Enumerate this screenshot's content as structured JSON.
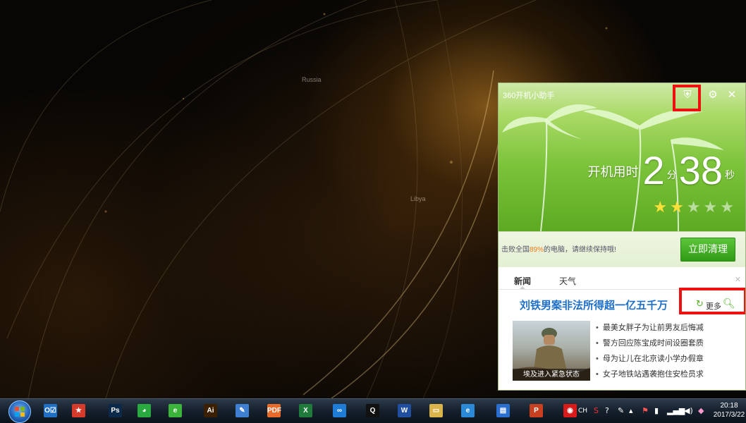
{
  "desktop": {
    "map_labels": [
      "Russia",
      "Libya"
    ]
  },
  "widget": {
    "title": "360开机小助手",
    "icons": {
      "skin": "tshirt-icon",
      "settings": "gear-icon",
      "close": "close-icon"
    },
    "boot": {
      "label": "开机用时",
      "minutes": "2",
      "minutes_unit": "分",
      "seconds": "38",
      "seconds_unit": "秒"
    },
    "rating": {
      "stars_on": 2,
      "stars_total": 5
    },
    "message": {
      "prefix": "击败全国",
      "percent": "89%",
      "suffix": "的电脑，请继续保持哦!"
    },
    "clean_button": "立即清理",
    "news": {
      "tabs": [
        "新闻",
        "天气"
      ],
      "active_tab": "新闻",
      "headline": "刘铁男案非法所得超一亿五千万",
      "more_label": "更多",
      "thumb_caption": "埃及进入紧急状态",
      "items": [
        "最美女胖子为让前男友后悔减",
        "警方回应陈宝成时间设圈套质",
        "母为让儿在北京读小学办假章",
        "女子地铁站遇袭抱住安检员求"
      ]
    }
  },
  "taskbar": {
    "apps": [
      {
        "name": "outlook",
        "label": "O☑",
        "color": "#1f6fc4"
      },
      {
        "name": "bookmark",
        "label": "★",
        "color": "#d63a2a"
      },
      {
        "name": "photoshop",
        "label": "Ps",
        "color": "#0b2a4a"
      },
      {
        "name": "wechat",
        "label": "◕",
        "color": "#2aa940"
      },
      {
        "name": "browser-360",
        "label": "e",
        "color": "#3cb43c"
      },
      {
        "name": "illustrator",
        "label": "Ai",
        "color": "#3a1f00"
      },
      {
        "name": "notes",
        "label": "✎",
        "color": "#3f7fd1"
      },
      {
        "name": "pdf",
        "label": "PDF",
        "color": "#e86a2a"
      },
      {
        "name": "excel",
        "label": "X",
        "color": "#1f7a3c"
      },
      {
        "name": "sync",
        "label": "∞",
        "color": "#1e7bd6"
      },
      {
        "name": "qq",
        "label": "Q",
        "color": "#111"
      },
      {
        "name": "word",
        "label": "W",
        "color": "#1f4f9e"
      },
      {
        "name": "explorer",
        "label": "▭",
        "color": "#d9b44a"
      },
      {
        "name": "ie",
        "label": "e",
        "color": "#2a8ad8"
      },
      {
        "name": "app-blue",
        "label": "▤",
        "color": "#2a6fd0"
      },
      {
        "name": "powerpoint",
        "label": "P",
        "color": "#c8401f"
      },
      {
        "name": "netease",
        "label": "◉",
        "color": "#d71a1a"
      }
    ],
    "tray": {
      "ime": "CH",
      "time": "20:18",
      "date": "2017/3/22"
    }
  }
}
